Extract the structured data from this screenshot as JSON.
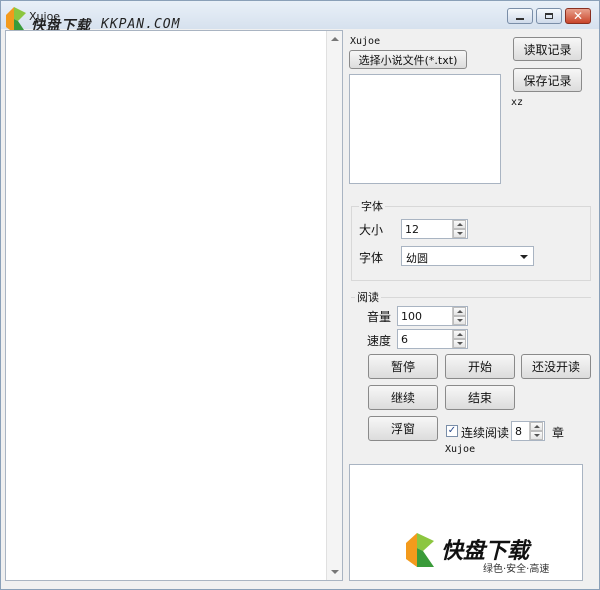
{
  "window": {
    "title": "Xujoe",
    "watermark_text": "快盘下载",
    "watermark_domain": "KKPAN.COM"
  },
  "right": {
    "author_label": "Xujoe",
    "choose_file_button": "选择小说文件(*.txt)",
    "read_record_button": "读取记录",
    "save_record_button": "保存记录",
    "xz_label": "xz"
  },
  "font_group": {
    "title": "字体",
    "size_label": "大小",
    "size_value": "12",
    "font_label": "字体",
    "font_value": "幼圆"
  },
  "read_group": {
    "title": "阅读",
    "volume_label": "音量",
    "volume_value": "100",
    "speed_label": "速度",
    "speed_value": "6",
    "pause_button": "暂停",
    "start_button": "开始",
    "not_started_button": "还没开读",
    "continue_button": "继续",
    "end_button": "结束",
    "float_button": "浮窗",
    "continuous_label": "连续阅读",
    "continuous_checked": true,
    "chapter_value": "8",
    "chapter_label": "章",
    "author_label": "Xujoe"
  },
  "bottom_watermark": {
    "title": "快盘下载",
    "subtitle": "绿色·安全·高速"
  }
}
